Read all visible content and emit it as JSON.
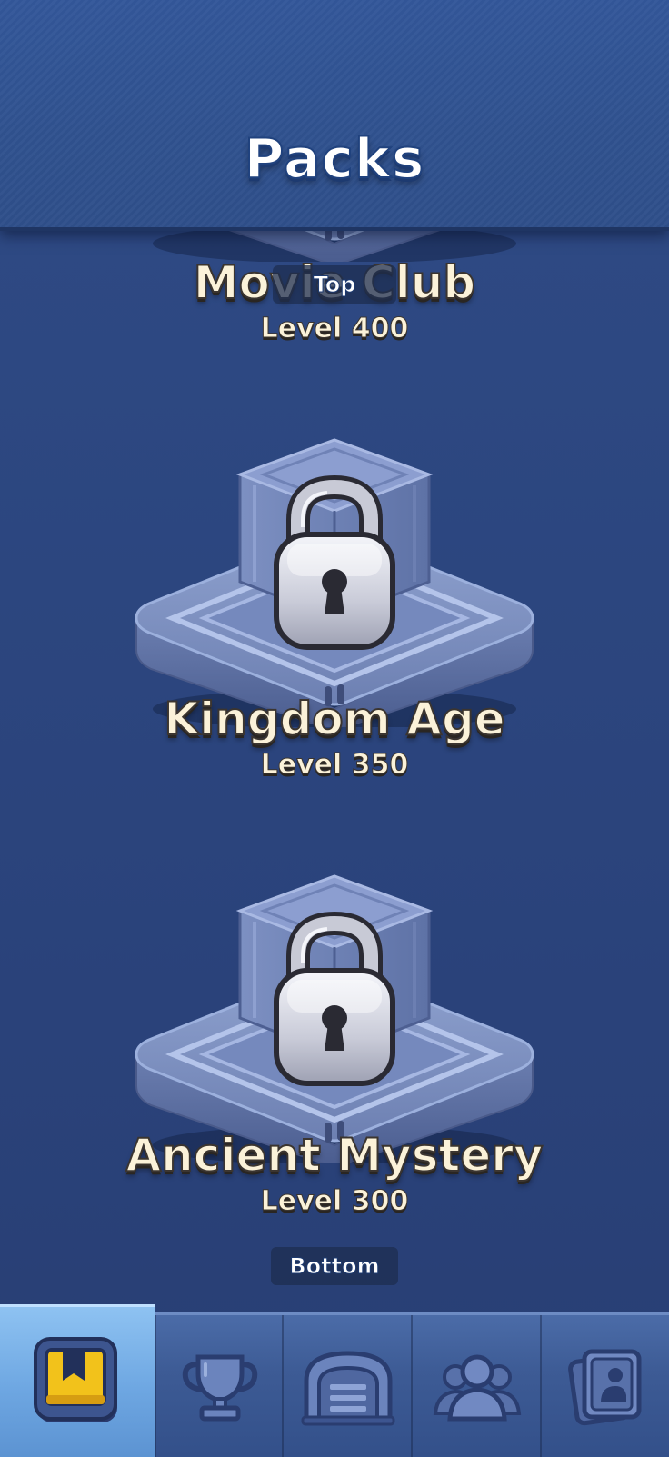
{
  "header": {
    "title": "Packs"
  },
  "packs": [
    {
      "name": "Movie Club",
      "level": "Level 400",
      "locked": true
    },
    {
      "name": "Kingdom Age",
      "level": "Level 350",
      "locked": true
    },
    {
      "name": "Ancient Mystery",
      "level": "Level 300",
      "locked": true
    }
  ],
  "scroll": {
    "top_label": "Top",
    "bottom_label": "Bottom"
  },
  "bottom_nav": {
    "active_index": 0,
    "tabs": [
      {
        "icon": "bookmark-icon"
      },
      {
        "icon": "trophy-icon"
      },
      {
        "icon": "shop-icon"
      },
      {
        "icon": "friends-icon"
      },
      {
        "icon": "collection-icon"
      }
    ]
  },
  "colors": {
    "background": "#2c467f",
    "header": "#30528f",
    "title_text": "#fbf2d9",
    "active_tab": "#6ea7e2",
    "bookmark_gold": "#f2c21b"
  }
}
